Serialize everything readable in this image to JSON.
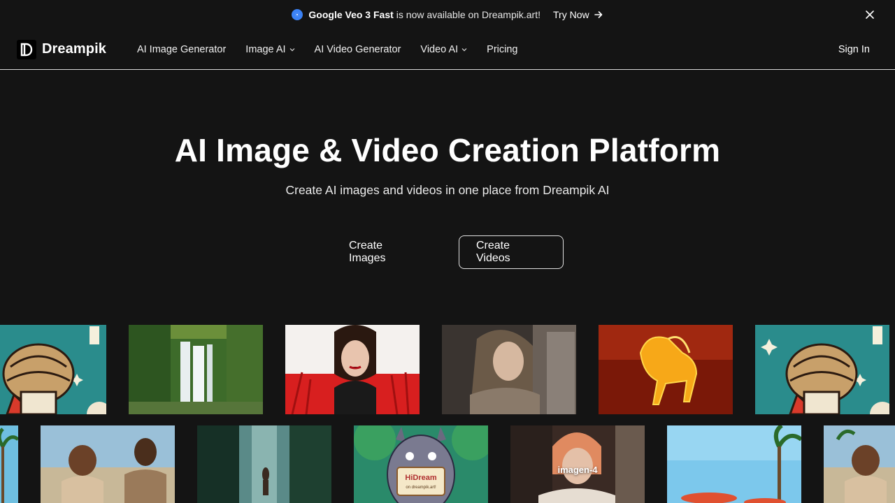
{
  "announcement": {
    "highlight": "Google Veo 3 Fast",
    "text": "is now available on Dreampik.art!",
    "cta": "Try Now",
    "icons": {
      "badge": "circle-dot-icon",
      "cta": "arrow-right-icon",
      "close": "close-icon"
    }
  },
  "nav": {
    "brand": "Dreampik",
    "items": [
      {
        "label": "AI Image Generator",
        "dropdown": false
      },
      {
        "label": "Image AI",
        "dropdown": true
      },
      {
        "label": "AI Video Generator",
        "dropdown": false
      },
      {
        "label": "Video AI",
        "dropdown": true
      },
      {
        "label": "Pricing",
        "dropdown": false
      }
    ],
    "sign_in": "Sign In"
  },
  "hero": {
    "title": "AI Image & Video Creation Platform",
    "subtitle": "Create AI images and videos in one place from Dreampik AI",
    "buttons": {
      "create_images": "Create Images",
      "create_videos": "Create Videos"
    }
  },
  "gallery": {
    "row2_overlay_label": "imagen-4",
    "row2_badge_text": "HiDream",
    "row2_badge_sub": "on dreampik.art!"
  },
  "colors": {
    "background": "#141414",
    "accent": "#3b82f6",
    "divider": "#d9d9d9"
  }
}
